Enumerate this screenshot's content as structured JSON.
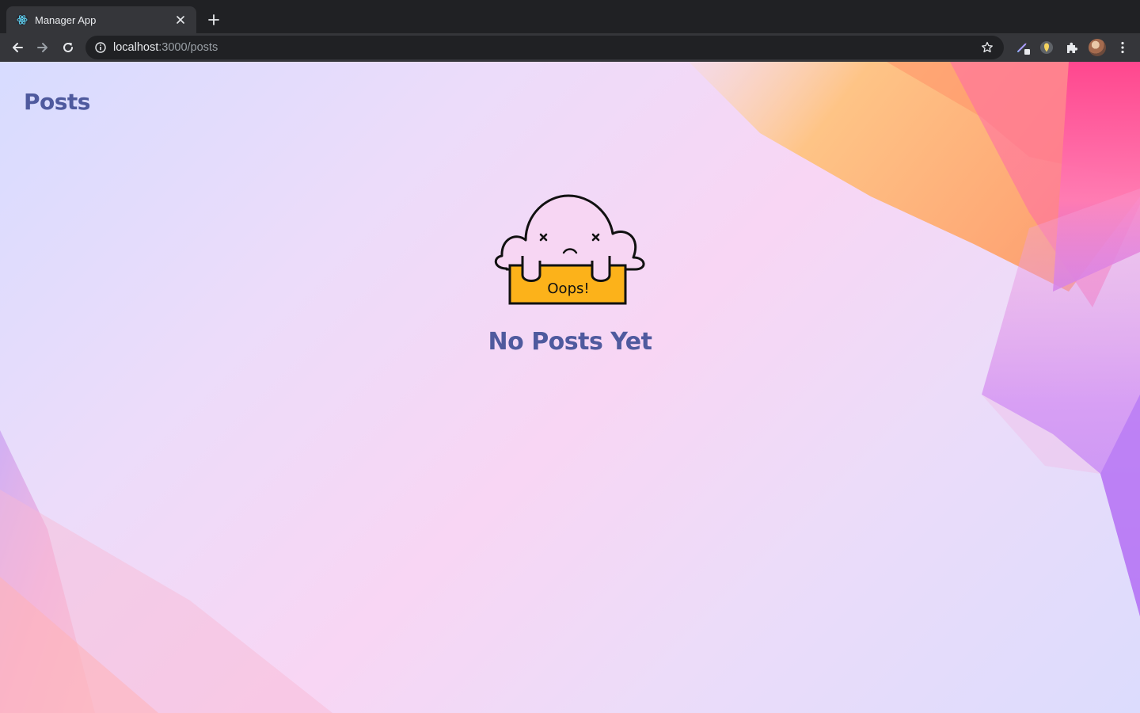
{
  "browser": {
    "tab": {
      "title": "Manager App",
      "favicon": "react-icon"
    },
    "address_bar": {
      "host": "localhost",
      "path": ":3000/posts"
    }
  },
  "page": {
    "title": "Posts",
    "empty_state": {
      "illustration_sign": "Oops!",
      "heading": "No Posts Yet"
    }
  },
  "colors": {
    "heading": "#4f5a9e",
    "sign_fill": "#fcb21a",
    "chrome_dark": "#202124",
    "chrome_toolbar": "#35363a"
  }
}
